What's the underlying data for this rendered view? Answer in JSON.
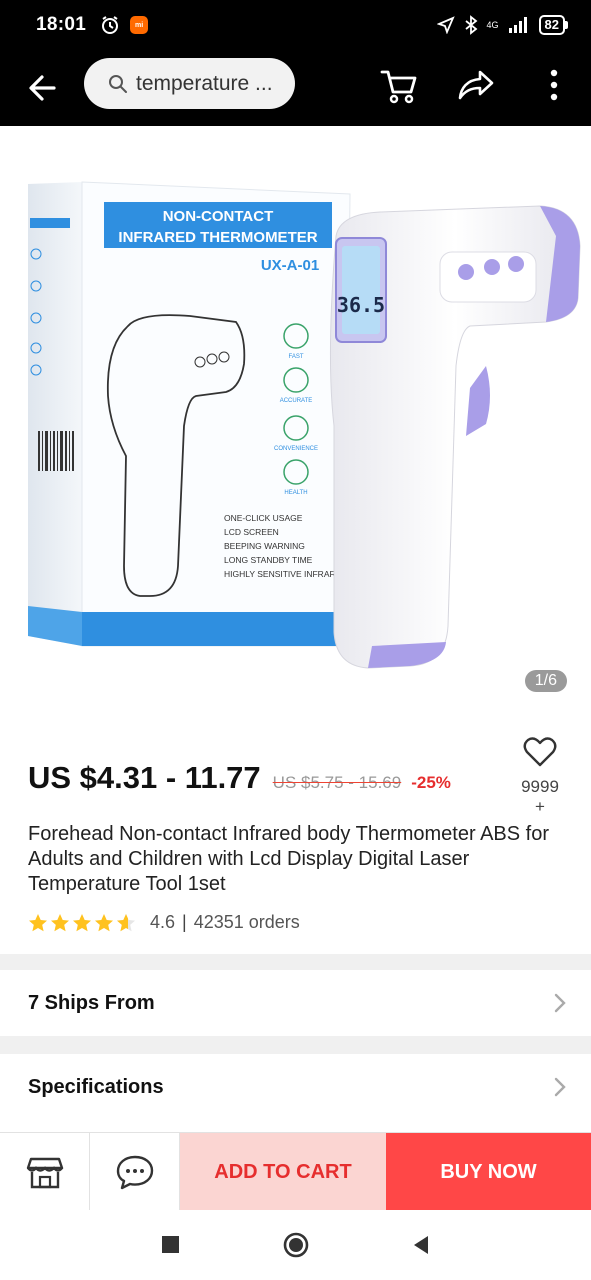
{
  "status_bar": {
    "time": "18:01",
    "network": "4G",
    "battery": "82"
  },
  "search": {
    "query": "temperature ..."
  },
  "gallery": {
    "box_title": "NON-CONTACT INFRARED THERMOMETER",
    "model": "UX-A-01",
    "display_reading": "36.5",
    "features": [
      "ONE-CLICK USAGE",
      "LCD SCREEN",
      "BEEPING WARNING",
      "LONG STANDBY TIME",
      "HIGHLY SENSITIVE INFRARED CONTROLLER"
    ],
    "side_icons": [
      "FAST",
      "ACCURATE",
      "CONVENIENCE",
      "HEALTH"
    ],
    "page_indicator": "1/6"
  },
  "product": {
    "price": "US $4.31 - 11.77",
    "original_price": "US $5.75 - 15.69",
    "discount": "-25%",
    "wishlist_count": "9999",
    "wishlist_plus": "+",
    "title": "Forehead Non-contact Infrared body Thermometer ABS for Adults and Children with Lcd Display Digital Laser Temperature Tool 1set",
    "rating": "4.6",
    "orders": "42351 orders",
    "rating_value": 4.6
  },
  "sections": {
    "ships_from": "7 Ships From",
    "specifications": "Specifications"
  },
  "actions": {
    "add_to_cart": "ADD TO CART",
    "buy_now": "BUY NOW"
  },
  "colors": {
    "accent_red": "#ff4747",
    "add_cart_bg": "#fbd5d2",
    "star": "#ffc21f",
    "box_blue": "#2f8fe0",
    "device_purple": "#a99ee8"
  }
}
